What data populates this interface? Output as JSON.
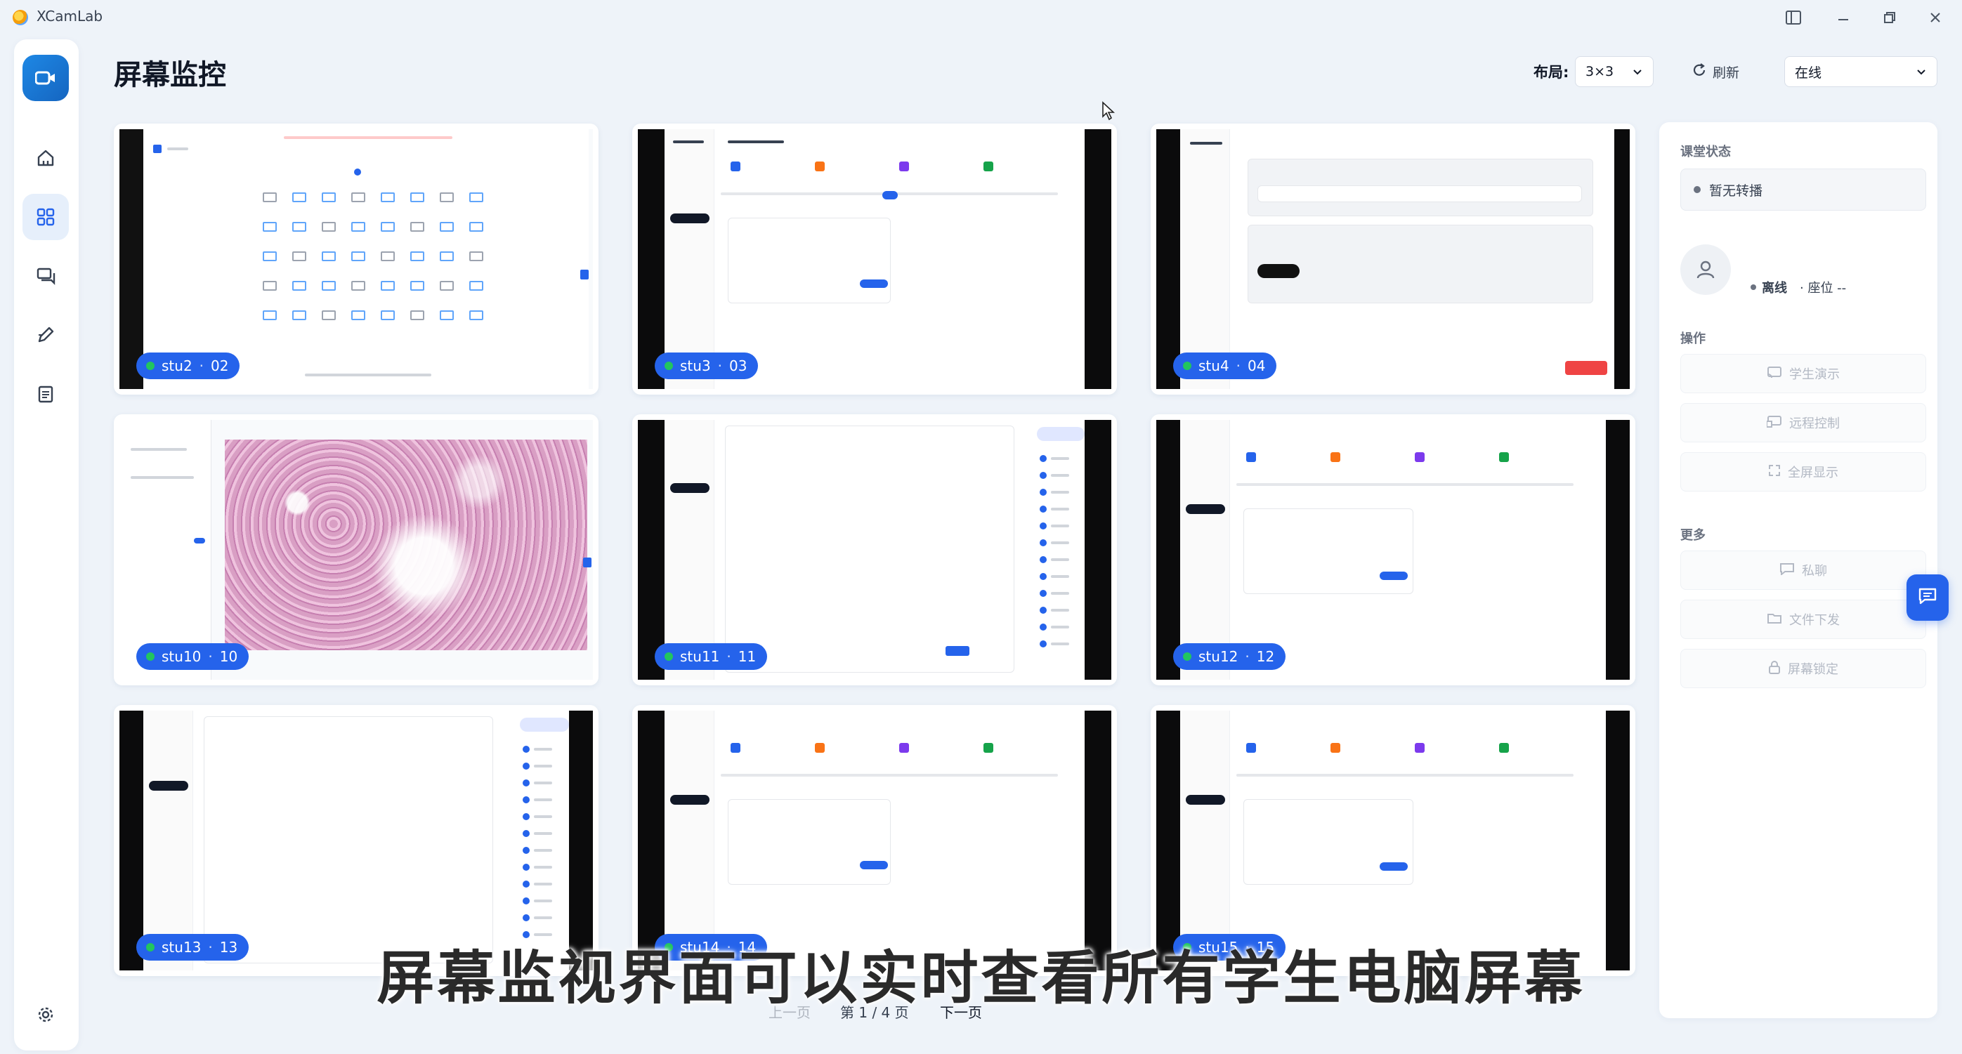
{
  "app": {
    "name": "XCamLab"
  },
  "header": {
    "title": "屏幕监控",
    "layout_label": "布局:",
    "layout_value": "3×3",
    "refresh_label": "刷新",
    "filter_value": "在线"
  },
  "tiles": [
    {
      "name": "stu2",
      "seat": "02"
    },
    {
      "name": "stu3",
      "seat": "03"
    },
    {
      "name": "stu4",
      "seat": "04"
    },
    {
      "name": "stu10",
      "seat": "10"
    },
    {
      "name": "stu11",
      "seat": "11"
    },
    {
      "name": "stu12",
      "seat": "12"
    },
    {
      "name": "stu13",
      "seat": "13"
    },
    {
      "name": "stu14",
      "seat": "14"
    },
    {
      "name": "stu15",
      "seat": "15"
    }
  ],
  "tile_sep": "·",
  "right_panel": {
    "class_status_title": "课堂状态",
    "class_status_value": "暂无转播",
    "student_status": "离线",
    "seat_label": "· 座位 --",
    "operations_title": "操作",
    "ops": [
      "学生演示",
      "远程控制",
      "全屏显示"
    ],
    "more_title": "更多",
    "more": [
      "私聊",
      "文件下发",
      "屏幕锁定"
    ]
  },
  "pager": {
    "prev": "上一页",
    "page": "第 1 / 4 页",
    "next": "下一页"
  },
  "subtitle": "屏幕监视界面可以实时查看所有学生电脑屏幕",
  "colors": {
    "accent": "#2563eb",
    "online": "#22c55e",
    "danger": "#ef4444"
  }
}
